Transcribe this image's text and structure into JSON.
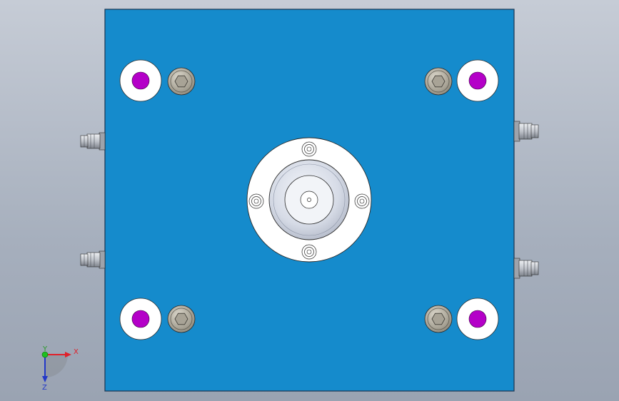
{
  "viewport": {
    "background_top": "#c6ccd6",
    "background_bottom": "#9aa3b2"
  },
  "plate": {
    "color": "#158bcc",
    "edge_color": "#1a3550"
  },
  "parts": {
    "bushing_face": "#ffffff",
    "guide_pin_color": "#b400c8",
    "screw_color": "#b7b2a6",
    "fitting_color": "#d8dade"
  },
  "triad": {
    "x_label": "X",
    "y_label": "Y",
    "z_label": "Z",
    "x_color": "#e0202a",
    "y_color": "#2a9a2a",
    "z_color": "#2338c8",
    "origin_color": "#1fc01f"
  }
}
